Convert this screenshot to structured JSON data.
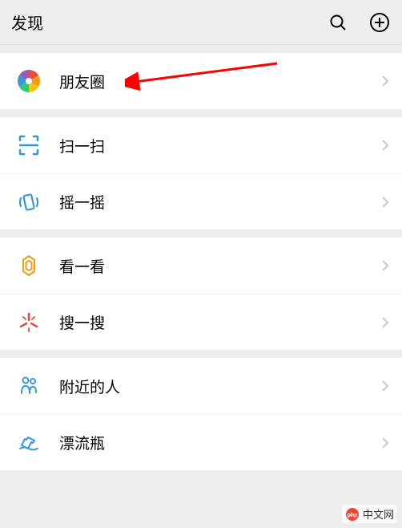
{
  "header": {
    "title": "发现"
  },
  "sections": [
    {
      "items": [
        {
          "label": "朋友圈",
          "icon": "moments-icon"
        }
      ]
    },
    {
      "items": [
        {
          "label": "扫一扫",
          "icon": "scan-icon"
        },
        {
          "label": "摇一摇",
          "icon": "shake-icon"
        }
      ]
    },
    {
      "items": [
        {
          "label": "看一看",
          "icon": "look-icon"
        },
        {
          "label": "搜一搜",
          "icon": "search-square-icon"
        }
      ]
    },
    {
      "items": [
        {
          "label": "附近的人",
          "icon": "nearby-icon"
        },
        {
          "label": "漂流瓶",
          "icon": "bottle-icon"
        }
      ]
    }
  ],
  "watermark": {
    "text": "中文网"
  },
  "annotation": {
    "arrow_target": "朋友圈",
    "arrow_color": "#ff0000"
  }
}
